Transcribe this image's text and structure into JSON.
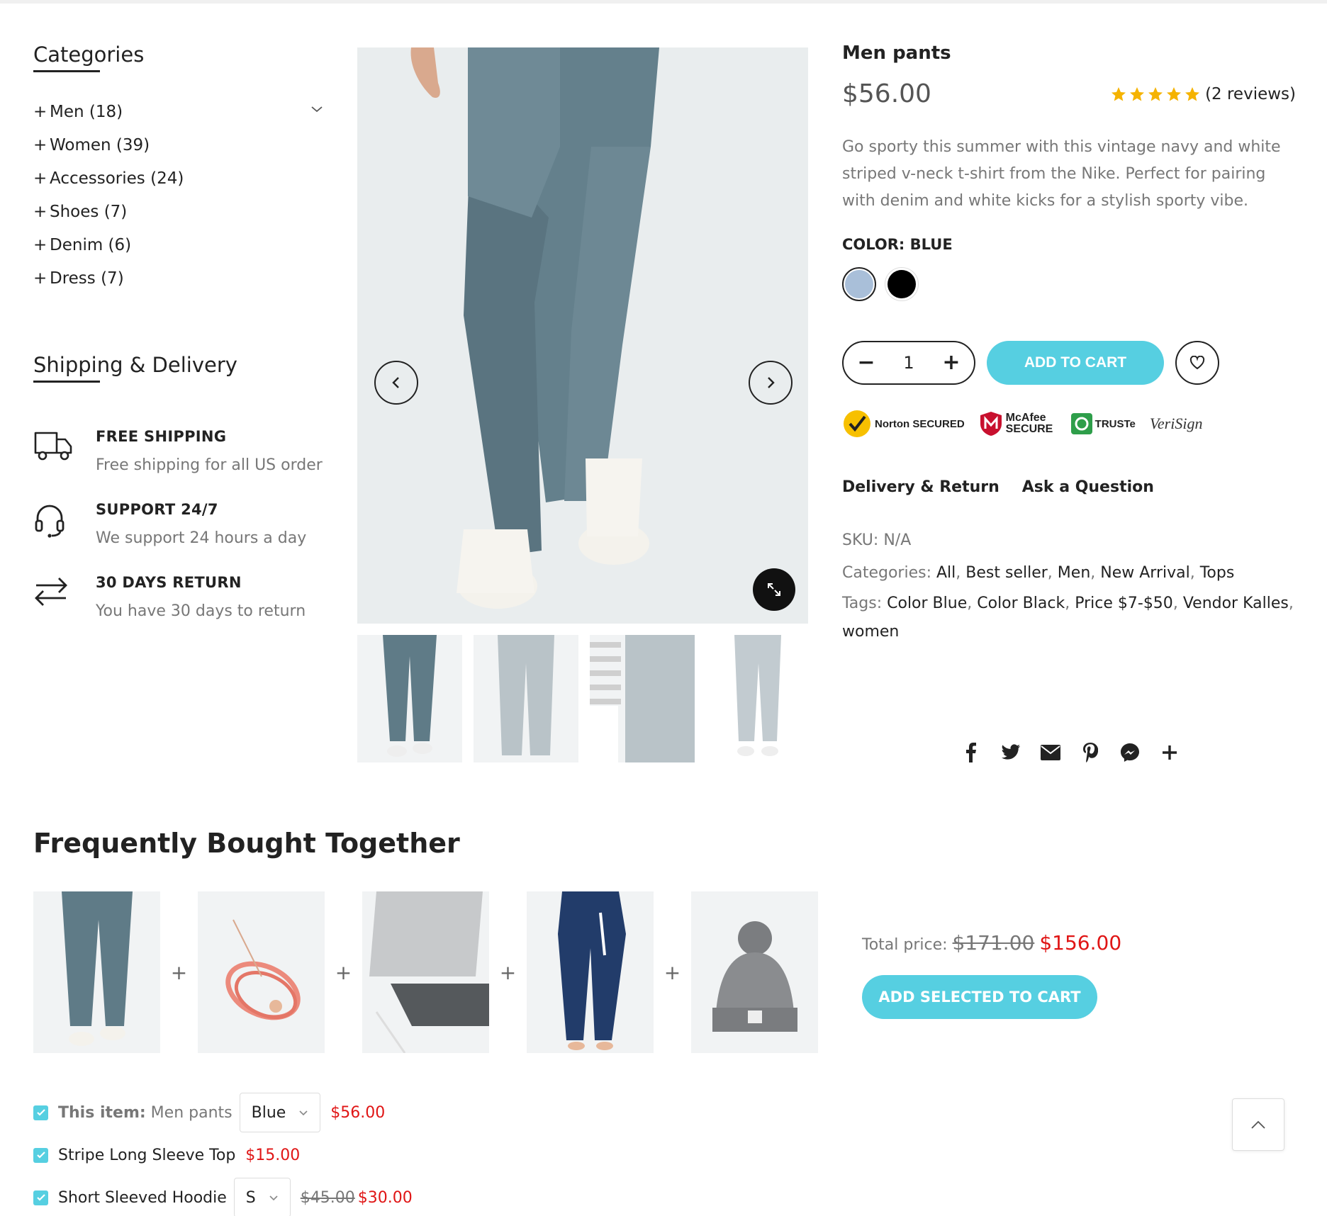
{
  "sidebar": {
    "categories_title": "Categories",
    "categories": [
      {
        "label": "Men (18)"
      },
      {
        "label": "Women (39)"
      },
      {
        "label": "Accessories (24)"
      },
      {
        "label": "Shoes (7)"
      },
      {
        "label": "Denim (6)"
      },
      {
        "label": "Dress (7)"
      }
    ],
    "shipping_title": "Shipping & Delivery",
    "features": [
      {
        "icon": "truck-icon",
        "title": "FREE SHIPPING",
        "subtitle": "Free shipping for all US order"
      },
      {
        "icon": "headset-icon",
        "title": "SUPPORT 24/7",
        "subtitle": "We support 24 hours a day"
      },
      {
        "icon": "return-arrows-icon",
        "title": "30 DAYS RETURN",
        "subtitle": "You have 30 days to return"
      }
    ]
  },
  "product": {
    "title": "Men pants",
    "price": "$56.00",
    "rating": 5,
    "reviews": "(2 reviews)",
    "description": "Go sporty this summer with this vintage navy and white striped v-neck t-shirt from the Nike. Perfect for pairing with denim and white kicks for a stylish sporty vibe.",
    "color_label": "COLOR: BLUE",
    "colors": [
      "#a9bfd9",
      "#000000"
    ],
    "quantity": "1",
    "add_to_cart": "ADD TO CART",
    "trust_badges": [
      "Norton SECURED",
      "McAfee SECURE",
      "TRUSTe",
      "VeriSign"
    ],
    "tabs": [
      "Delivery & Return",
      "Ask a Question"
    ],
    "sku_label": "SKU:",
    "sku": "N/A",
    "categories_label": "Categories:",
    "categories": [
      "All",
      "Best seller",
      "Men",
      "New Arrival",
      "Tops"
    ],
    "tags_label": "Tags:",
    "tags": [
      "Color Blue",
      "Color Black",
      "Price $7-$50",
      "Vendor Kalles",
      "women"
    ]
  },
  "fbt": {
    "title": "Frequently Bought Together",
    "total_label": "Total price:",
    "total_old": "$171.00",
    "total_new": "$156.00",
    "add_selected": "ADD SELECTED TO CART",
    "items": [
      {
        "prefix": "This item:",
        "name": "Men pants",
        "variant": "Blue",
        "old_price": "",
        "price": "$56.00"
      },
      {
        "prefix": "",
        "name": "Stripe Long Sleeve Top",
        "variant": "",
        "old_price": "",
        "price": "$15.00"
      },
      {
        "prefix": "",
        "name": "Short Sleeved Hoodie",
        "variant": "S",
        "old_price": "$45.00",
        "price": "$30.00"
      }
    ]
  },
  "colors": {
    "accent": "#56cfe1",
    "sale": "#e01515",
    "star": "#f5b301"
  }
}
